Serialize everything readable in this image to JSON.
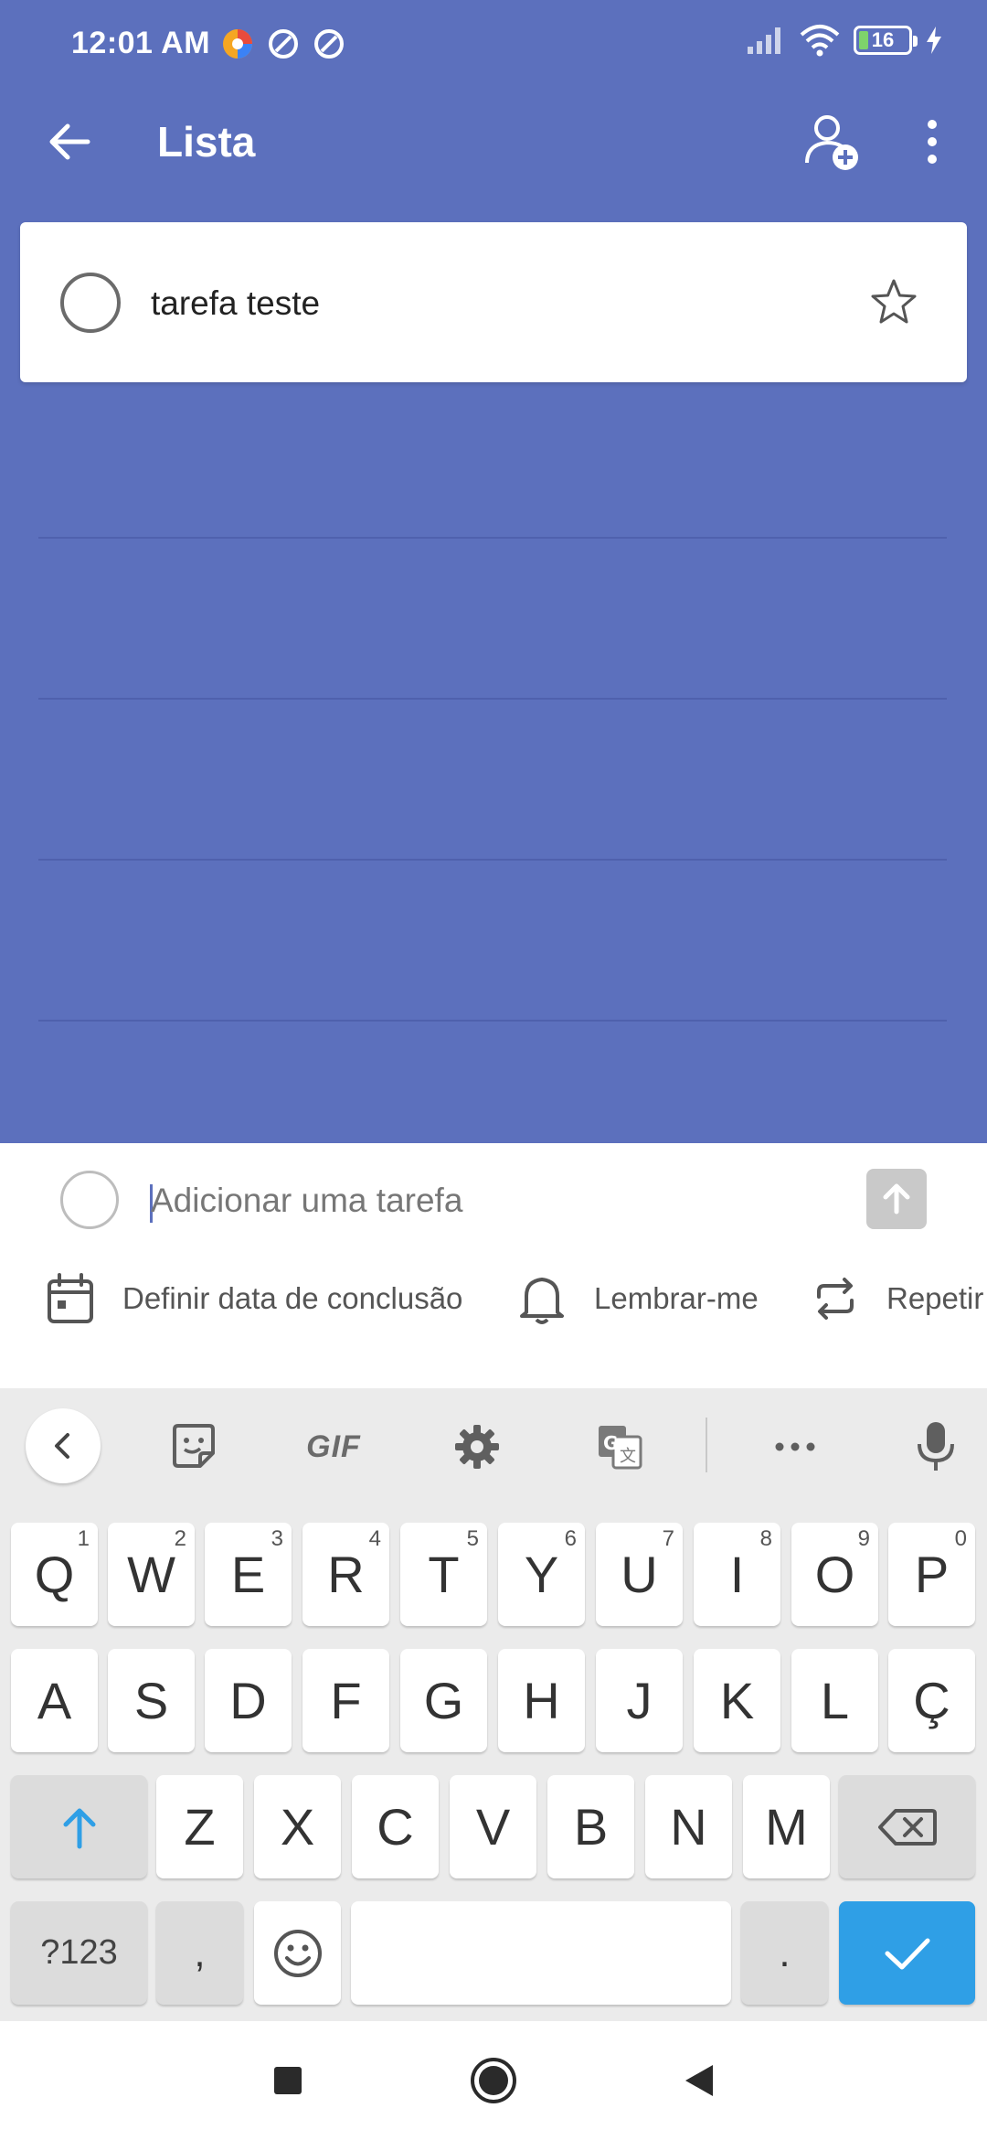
{
  "status": {
    "time": "12:01 AM",
    "battery": "16"
  },
  "header": {
    "title": "Lista"
  },
  "tasks": [
    {
      "title": "tarefa teste"
    }
  ],
  "add_task": {
    "placeholder": "Adicionar uma tarefa",
    "options": {
      "due_date": "Definir data de conclusão",
      "remind": "Lembrar-me",
      "repeat": "Repetir"
    }
  },
  "keyboard": {
    "toolbar": {
      "gif": "GIF"
    },
    "row1": [
      {
        "k": "Q",
        "n": "1"
      },
      {
        "k": "W",
        "n": "2"
      },
      {
        "k": "E",
        "n": "3"
      },
      {
        "k": "R",
        "n": "4"
      },
      {
        "k": "T",
        "n": "5"
      },
      {
        "k": "Y",
        "n": "6"
      },
      {
        "k": "U",
        "n": "7"
      },
      {
        "k": "I",
        "n": "8"
      },
      {
        "k": "O",
        "n": "9"
      },
      {
        "k": "P",
        "n": "0"
      }
    ],
    "row2": [
      "A",
      "S",
      "D",
      "F",
      "G",
      "H",
      "J",
      "K",
      "L",
      "Ç"
    ],
    "row3": [
      "Z",
      "X",
      "C",
      "V",
      "B",
      "N",
      "M"
    ],
    "symbols": "?123",
    "comma": ",",
    "period": "."
  },
  "colors": {
    "primary": "#5c70bd",
    "accent_blue": "#2f9fe6",
    "battery_green": "#7ed36b"
  }
}
